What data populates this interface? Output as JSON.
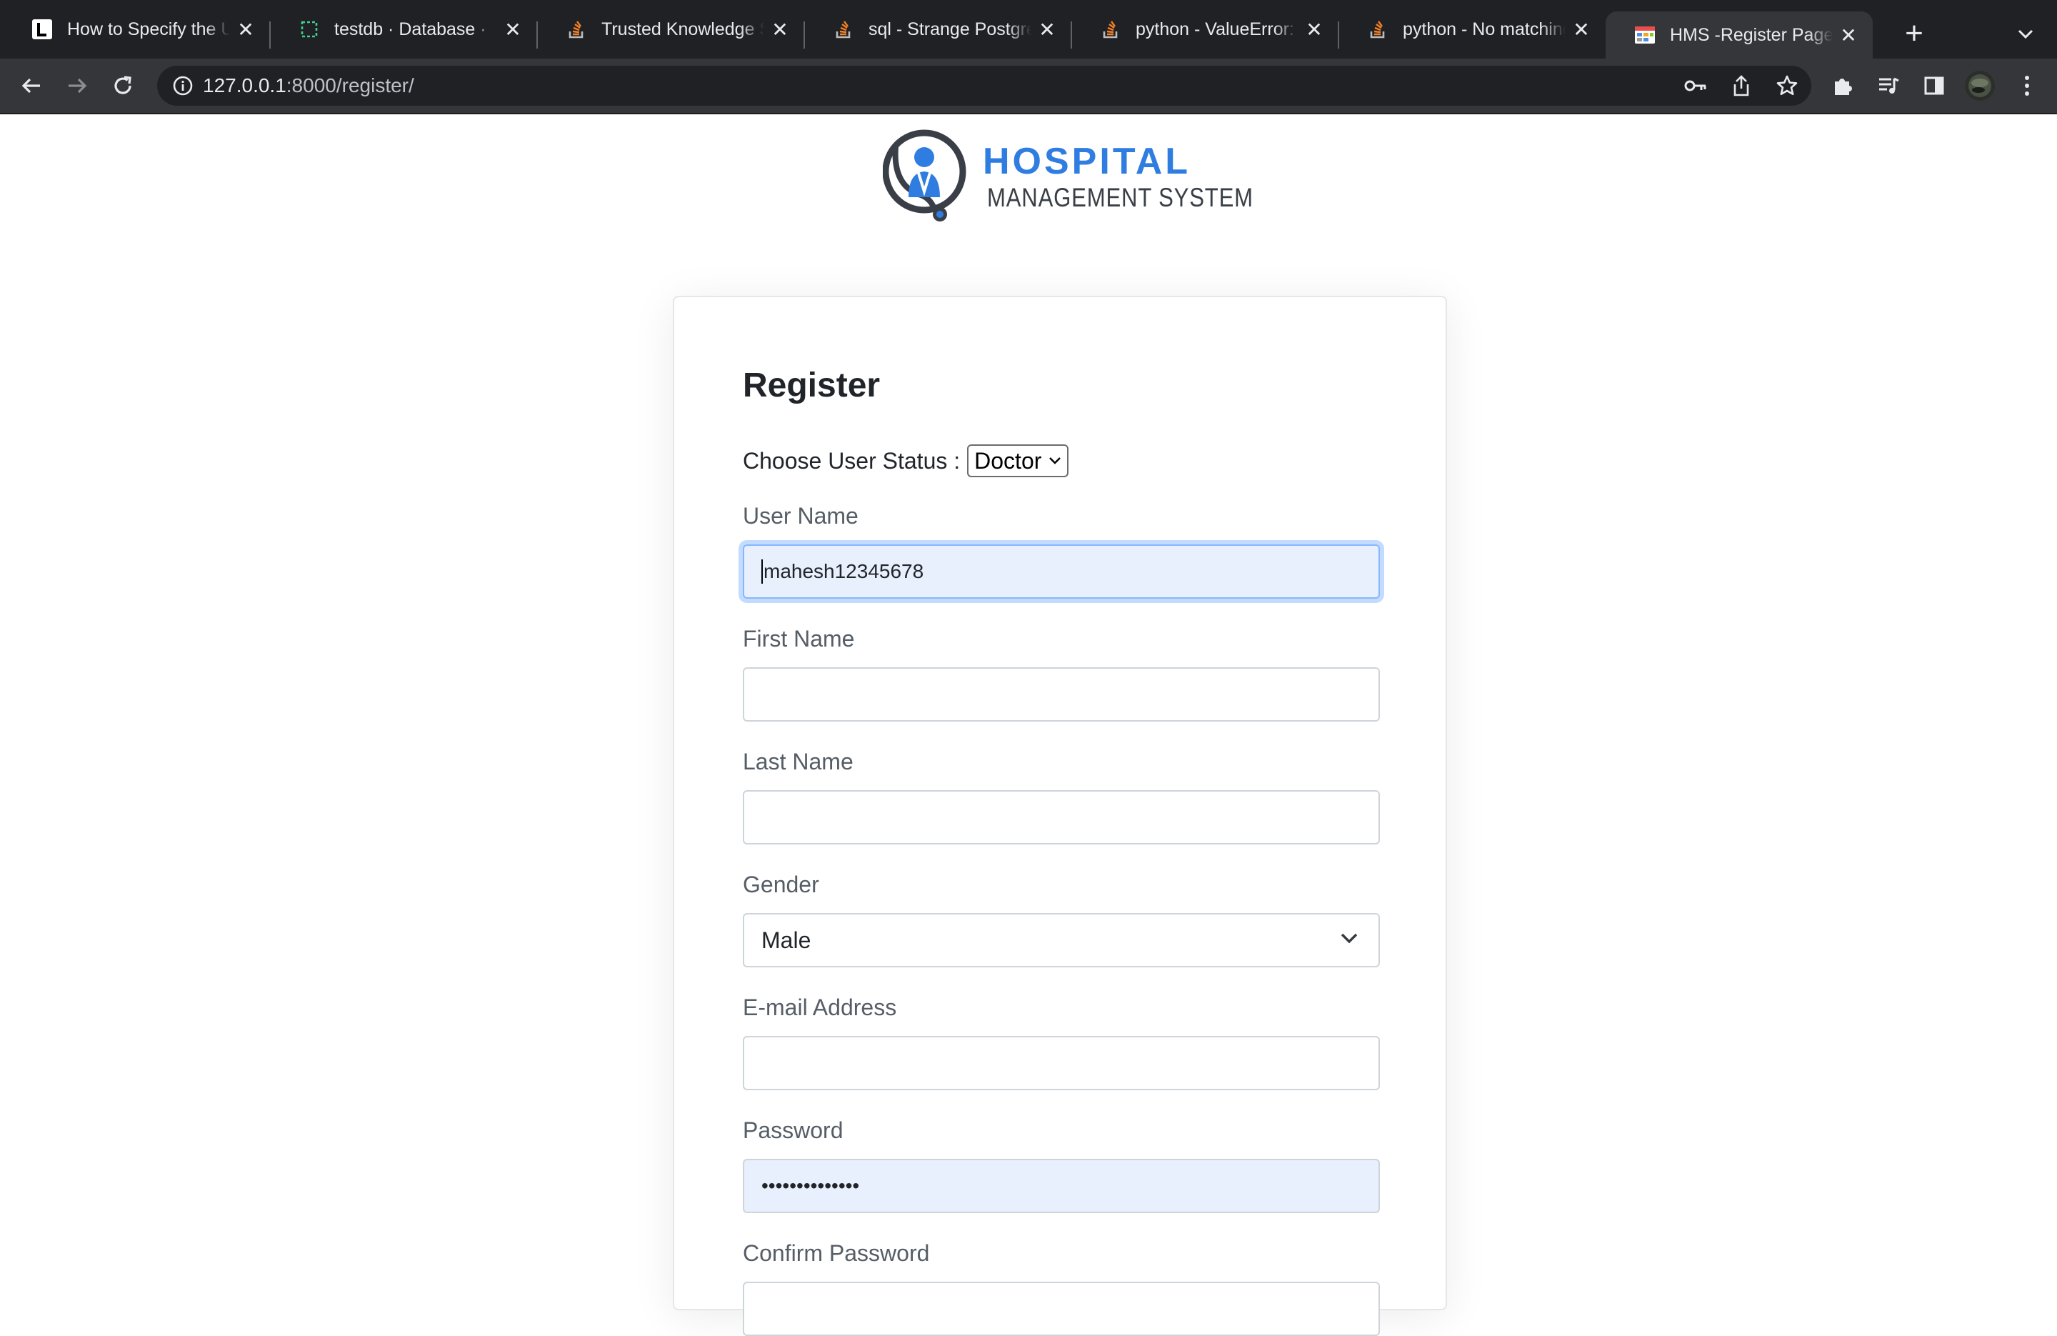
{
  "browser": {
    "tabs": [
      {
        "title": "How to Specify the UI",
        "favicon": "l-logo-icon",
        "active": false
      },
      {
        "title": "testdb · Database ·",
        "favicon": "database-icon",
        "active": false
      },
      {
        "title": "Trusted Knowledge Sharing",
        "favicon": "stackoverflow-icon",
        "active": false
      },
      {
        "title": "sql - Strange Postgres",
        "favicon": "stackoverflow-icon",
        "active": false
      },
      {
        "title": "python - ValueError: In",
        "favicon": "stackoverflow-icon",
        "active": false
      },
      {
        "title": "python - No matching",
        "favicon": "stackoverflow-icon",
        "active": false
      },
      {
        "title": "HMS -Register Page",
        "favicon": "hms-icon",
        "active": true
      }
    ],
    "url_host": "127.0.0.1",
    "url_rest": ":8000/register/"
  },
  "logo": {
    "line1": "HOSPITAL",
    "line2": "MANAGEMENT SYSTEM",
    "brand_color": "#2f7de1"
  },
  "form": {
    "title": "Register",
    "status_label": "Choose User Status :",
    "status_value": "Doctor",
    "username_label": "User Name",
    "username_value": "mahesh12345678",
    "firstname_label": "First Name",
    "firstname_value": "",
    "lastname_label": "Last Name",
    "lastname_value": "",
    "gender_label": "Gender",
    "gender_value": "Male",
    "email_label": "E-mail Address",
    "email_value": "",
    "password_label": "Password",
    "password_value": "••••••••••••••",
    "confirm_label": "Confirm Password"
  }
}
